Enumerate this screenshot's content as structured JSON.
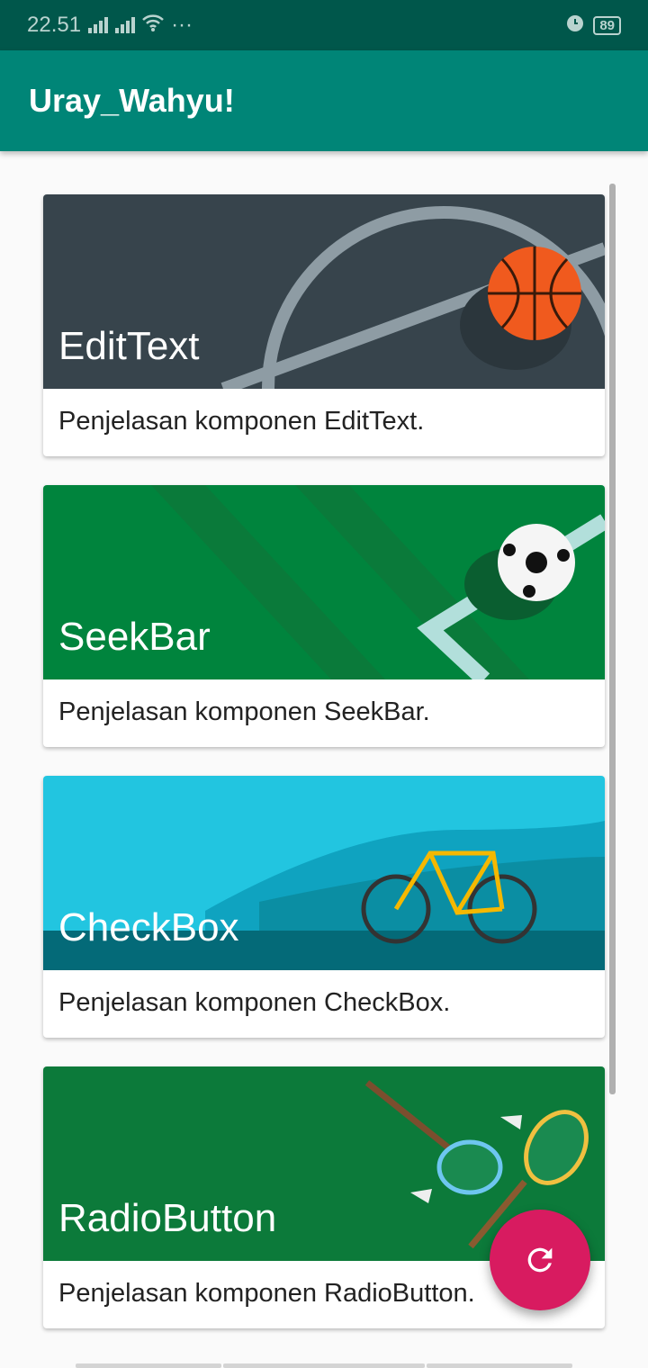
{
  "status_bar": {
    "time": "22.51",
    "battery": "89"
  },
  "app_bar": {
    "title": "Uray_Wahyu!"
  },
  "cards": [
    {
      "title": "EditText",
      "description": "Penjelasan komponen EditText.",
      "image": "basketball"
    },
    {
      "title": "SeekBar",
      "description": "Penjelasan komponen SeekBar.",
      "image": "soccer"
    },
    {
      "title": "CheckBox",
      "description": "Penjelasan komponen CheckBox.",
      "image": "cycling"
    },
    {
      "title": "RadioButton",
      "description": "Penjelasan komponen RadioButton.",
      "image": "badminton"
    }
  ],
  "fab": {
    "icon": "refresh-icon",
    "color": "#d81b60"
  },
  "colors": {
    "primary": "#008577",
    "primary_dark": "#00574b"
  }
}
